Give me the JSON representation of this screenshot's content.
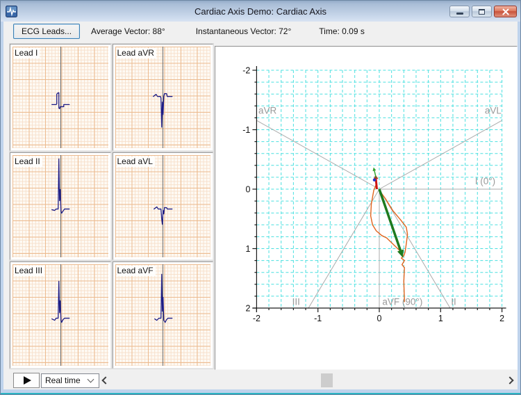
{
  "window": {
    "title": "Cardiac Axis Demo: Cardiac Axis",
    "app_icon": "ecg-pulse-icon",
    "controls": [
      "minimize",
      "maximize",
      "close"
    ],
    "colors": {
      "titlebar_top": "#93abc9",
      "titlebar_bottom": "#d8e3f2",
      "frame": "#bfd3ec",
      "bottom_accent": "#2ab3c3"
    }
  },
  "toolbar": {
    "ecg_leads_button": "ECG Leads...",
    "average_vector": "Average Vector: 88°",
    "instantaneous_vector": "Instantaneous Vector: 72°",
    "time": "Time: 0.09 s"
  },
  "leads": [
    {
      "label": "Lead I",
      "baseline": 0.57,
      "points": [
        [
          -12,
          0
        ],
        [
          -6,
          0
        ],
        [
          -5,
          -1
        ],
        [
          -5,
          -15
        ],
        [
          -3,
          -17
        ],
        [
          -2,
          -17
        ],
        [
          -2,
          5
        ],
        [
          -1,
          6
        ],
        [
          0,
          3
        ],
        [
          5,
          3
        ],
        [
          5,
          0
        ],
        [
          13,
          0
        ]
      ]
    },
    {
      "label": "Lead aVR",
      "baseline": 0.49,
      "points": [
        [
          -14,
          0
        ],
        [
          -10,
          -3
        ],
        [
          -8,
          0
        ],
        [
          -4,
          0
        ],
        [
          -3,
          2
        ],
        [
          -2,
          44
        ],
        [
          -1,
          8
        ],
        [
          0,
          26
        ],
        [
          1,
          0
        ],
        [
          2,
          -4
        ],
        [
          5,
          -4
        ],
        [
          6,
          0
        ],
        [
          13,
          0
        ]
      ]
    },
    {
      "label": "Lead II",
      "baseline": 0.53,
      "points": [
        [
          -12,
          1
        ],
        [
          -8,
          2
        ],
        [
          -6,
          0
        ],
        [
          -3,
          0
        ],
        [
          -2,
          -72
        ],
        [
          -1,
          -12
        ],
        [
          0,
          -28
        ],
        [
          1,
          3
        ],
        [
          2,
          6
        ],
        [
          4,
          3
        ],
        [
          6,
          0
        ],
        [
          13,
          0
        ]
      ]
    },
    {
      "label": "Lead aVL",
      "baseline": 0.53,
      "points": [
        [
          -13,
          0
        ],
        [
          -9,
          -3
        ],
        [
          -7,
          0
        ],
        [
          -3,
          0
        ],
        [
          -2,
          14
        ],
        [
          -1,
          22
        ],
        [
          0,
          2
        ],
        [
          1,
          7
        ],
        [
          2,
          -2
        ],
        [
          5,
          -2
        ],
        [
          6,
          0
        ],
        [
          13,
          0
        ]
      ]
    },
    {
      "label": "Lead III",
      "baseline": 0.53,
      "points": [
        [
          -12,
          1
        ],
        [
          -8,
          3
        ],
        [
          -6,
          0
        ],
        [
          -3,
          0
        ],
        [
          -2,
          -53
        ],
        [
          -1,
          -8
        ],
        [
          0,
          -25
        ],
        [
          1,
          3
        ],
        [
          2,
          6
        ],
        [
          4,
          2
        ],
        [
          6,
          0
        ],
        [
          13,
          0
        ]
      ]
    },
    {
      "label": "Lead aVF",
      "baseline": 0.53,
      "points": [
        [
          -12,
          1
        ],
        [
          -9,
          3
        ],
        [
          -6,
          0
        ],
        [
          -3,
          0
        ],
        [
          -2,
          -63
        ],
        [
          -1,
          -10
        ],
        [
          0,
          -30
        ],
        [
          1,
          3
        ],
        [
          3,
          6
        ],
        [
          5,
          2
        ],
        [
          7,
          0
        ],
        [
          13,
          0
        ]
      ]
    }
  ],
  "ecg_paper": {
    "fine_grid": "#f7e0cb",
    "bold_grid": "#ecbb90",
    "trace_color": "#1c1c86",
    "centerline": "#686868"
  },
  "chart_data": {
    "type": "line",
    "title": "Cardiac axis vector plot (hexaxial reference system)",
    "axis_range": [
      -2,
      2
    ],
    "grid_step": 0.2,
    "ticks": [
      -2,
      -1,
      0,
      1,
      2
    ],
    "grid_on": true,
    "grid_color": "#4ae0e0",
    "axis_color": "#1a1a1a",
    "tick_label_color": "#111111",
    "lead_axis_color": "#ababab",
    "lead_label_color": "#9a9a9a",
    "lead_axes": [
      {
        "label": "aVR",
        "from": [
          0,
          0
        ],
        "to": [
          -2,
          -1.155
        ],
        "label_at": [
          -1.97,
          -1.27
        ]
      },
      {
        "label": "aVL",
        "from": [
          0,
          0
        ],
        "to": [
          2,
          -1.155
        ],
        "label_at": [
          1.72,
          -1.27
        ]
      },
      {
        "label": "I (0°)",
        "from": [
          0,
          0
        ],
        "to": [
          2,
          0
        ],
        "label_at": [
          1.56,
          -0.08
        ]
      },
      {
        "label": "II",
        "from": [
          0,
          0
        ],
        "to": [
          1.155,
          2
        ],
        "label_at": [
          1.17,
          1.95
        ]
      },
      {
        "label": "III",
        "from": [
          0,
          0
        ],
        "to": [
          -1.155,
          2
        ],
        "label_at": [
          -1.42,
          1.95
        ]
      },
      {
        "label": "aVF (90°)",
        "from": [
          0,
          0
        ],
        "to": [
          0,
          2
        ],
        "label_at": [
          0.05,
          1.95
        ]
      }
    ],
    "trace": {
      "color": "#e2641c",
      "polylines": [
        [
          [
            -0.05,
            -0.08
          ],
          [
            -0.09,
            0.02
          ],
          [
            -0.13,
            0.25
          ],
          [
            -0.14,
            0.45
          ],
          [
            -0.11,
            0.6
          ],
          [
            -0.05,
            0.7
          ],
          [
            0.04,
            0.78
          ],
          [
            0.12,
            0.82
          ],
          [
            0.2,
            0.9
          ],
          [
            0.3,
            1.0
          ],
          [
            0.38,
            1.08
          ]
        ],
        [
          [
            0.0,
            0.02
          ],
          [
            0.1,
            0.16
          ],
          [
            0.22,
            0.36
          ],
          [
            0.35,
            0.52
          ],
          [
            0.44,
            0.64
          ],
          [
            0.46,
            0.76
          ],
          [
            0.44,
            0.92
          ],
          [
            0.42,
            1.06
          ],
          [
            0.4,
            1.12
          ],
          [
            0.36,
            1.16
          ],
          [
            0.41,
            1.2
          ],
          [
            0.37,
            1.27
          ],
          [
            0.41,
            1.32
          ],
          [
            0.4,
            1.55
          ],
          [
            0.41,
            1.9
          ]
        ]
      ]
    },
    "instantaneous_vector_arrow": {
      "from": [
        0,
        0
      ],
      "to": [
        0.345,
        1.03
      ],
      "angle_deg": 72,
      "color": "#1e7a1e",
      "width": 3.5
    },
    "red_vector_arrow": {
      "from": [
        -0.04,
        0.0
      ],
      "to": [
        -0.055,
        -0.17
      ],
      "color": "#cc1414",
      "width": 3
    },
    "small_green_arrow": {
      "from": [
        -0.05,
        -0.18
      ],
      "to": [
        -0.08,
        -0.31
      ],
      "color": "#2fa32f",
      "width": 1.5
    },
    "blue_dot": {
      "at": [
        -0.08,
        -0.155
      ],
      "radius": 2.2,
      "color": "#2236c8"
    }
  },
  "bottombar": {
    "play_button": "play-icon",
    "mode_value": "Real time",
    "scrollbar": {
      "left_arrow": "chevron-left-icon",
      "right_arrow": "chevron-right-icon",
      "thumb_pos": 0.53
    }
  }
}
